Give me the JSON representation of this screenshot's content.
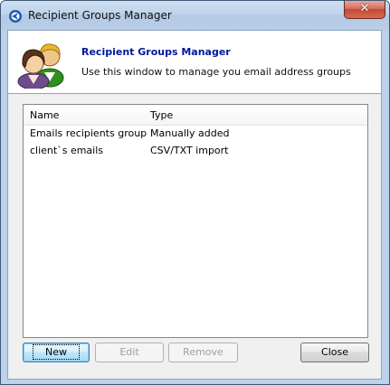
{
  "window": {
    "title": "Recipient Groups Manager"
  },
  "header": {
    "title": "Recipient Groups Manager",
    "subtitle": "Use this window to manage you email address groups",
    "icon": "users-icon"
  },
  "list": {
    "columns": [
      "Name",
      "Type"
    ],
    "rows": [
      {
        "name": "Emails recipients group",
        "type": "Manually added"
      },
      {
        "name": "client`s emails",
        "type": "CSV/TXT import"
      }
    ]
  },
  "buttons": {
    "new": "New",
    "edit": "Edit",
    "remove": "Remove",
    "close": "Close"
  }
}
